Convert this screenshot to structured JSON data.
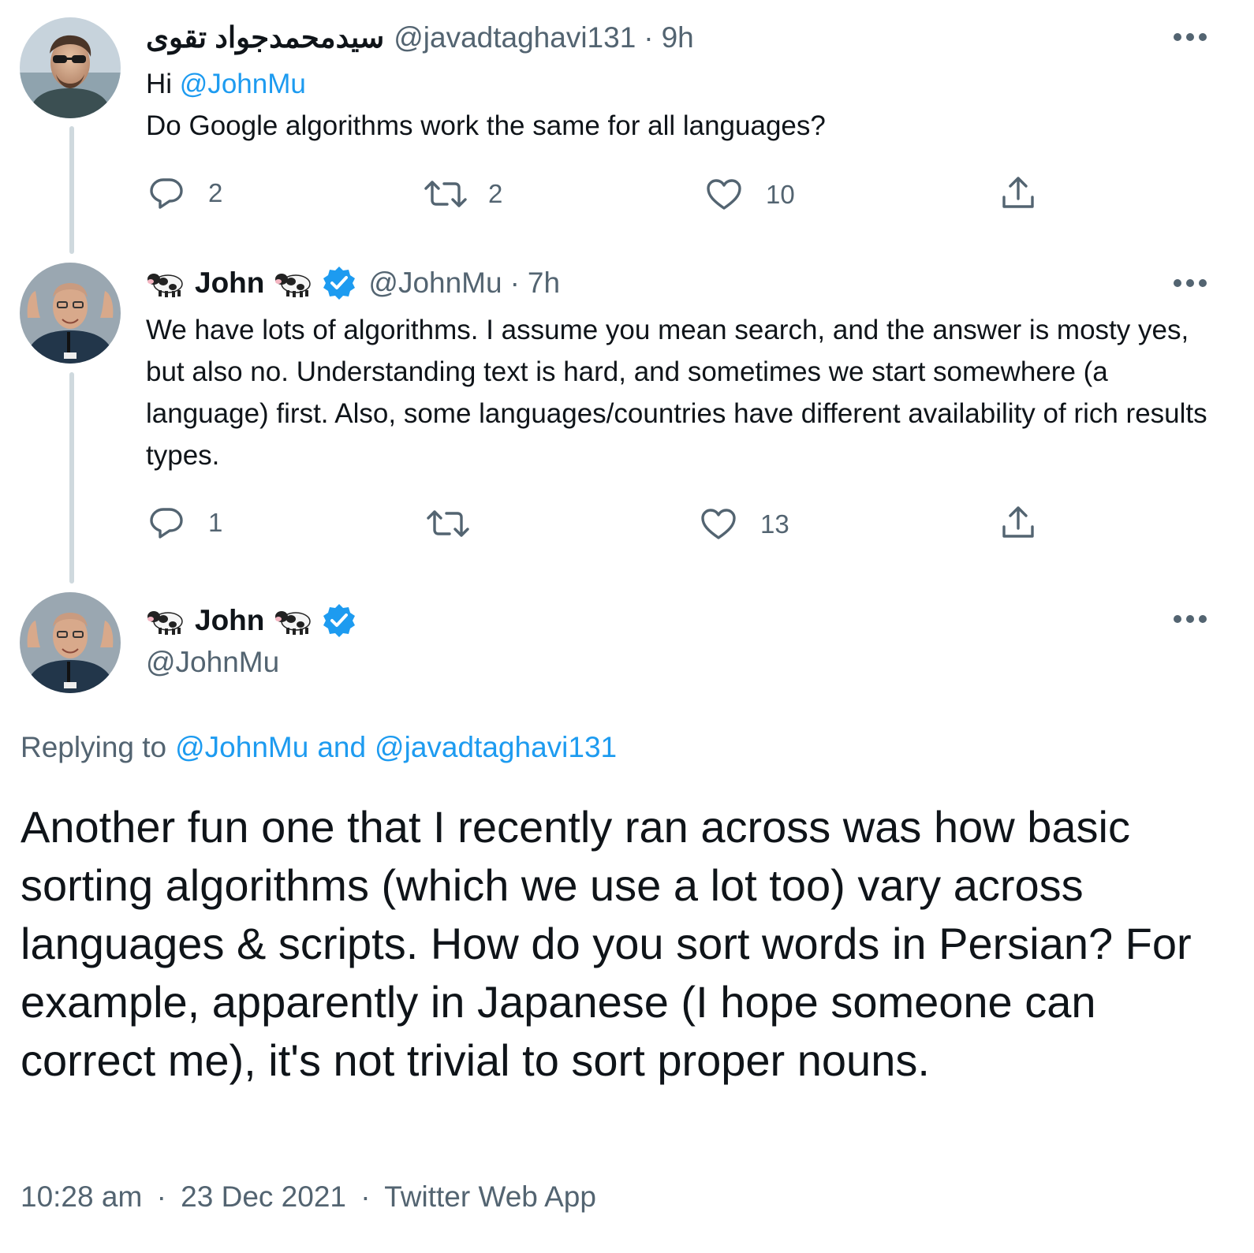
{
  "tweet1": {
    "display_name": "سیدمحمدجواد تقوی",
    "handle": "@javadtaghavi131",
    "time": "9h",
    "greeting": "Hi",
    "mention": "@JohnMu",
    "text": "Do Google algorithms work the same for all languages?",
    "replies": "2",
    "retweets": "2",
    "likes": "10"
  },
  "tweet2": {
    "display_name": "John",
    "handle": "@JohnMu",
    "time": "7h",
    "text": "We have lots of algorithms. I assume you mean search, and the answer is mosty yes, but also no. Understanding text is hard, and sometimes we start somewhere (a language) first. Also, some languages/countries have different availability of rich results types.",
    "replies": "1",
    "retweets": "",
    "likes": "13"
  },
  "main_tweet": {
    "display_name": "John",
    "handle": "@JohnMu",
    "replying_prefix": "Replying to",
    "replying_user1": "@JohnMu",
    "replying_and": "and",
    "replying_user2": "@javadtaghavi131",
    "text": "Another fun one that I recently ran across was how basic sorting algorithms (which we use a lot too) vary across languages & scripts. How do you sort words in Persian? For example, apparently in Japanese (I hope someone can correct me), it's not trivial to sort proper nouns.",
    "time": "10:28 am",
    "date": "23 Dec 2021",
    "source": "Twitter Web App"
  },
  "sep": "·",
  "icons": {
    "more": "more-icon",
    "reply": "reply-icon",
    "retweet": "retweet-icon",
    "like": "heart-icon",
    "share": "share-icon",
    "verified": "verified-badge-icon",
    "cow": "cow-emoji-icon"
  },
  "colors": {
    "link": "#1d9bf0",
    "text": "#0f1419",
    "muted": "#536471",
    "thread_line": "#cfd9de",
    "verified": "#1d9bf0"
  }
}
